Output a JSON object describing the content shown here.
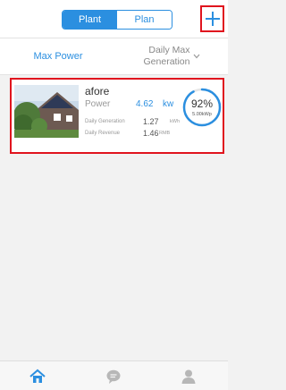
{
  "header": {
    "tabs": [
      {
        "label": "Plant",
        "active": true
      },
      {
        "label": "Plan",
        "active": false
      }
    ],
    "add_icon": "plus-icon"
  },
  "filters": {
    "left_label": "Max Power",
    "right_label": "Daily Max\nGeneration",
    "right_icon": "chevron-down-icon"
  },
  "plants": [
    {
      "name": "afore",
      "power_label": "Power",
      "power_value": "4.62",
      "power_unit": "kw",
      "generation_label": "Daily Generation",
      "generation_value": "1.27",
      "generation_unit": "kWh",
      "revenue_label": "Daily Revenue",
      "revenue_value": "1.46",
      "revenue_unit": "RMB",
      "percent_label": "92%",
      "percent": 0.92,
      "capacity": "5.00kWp"
    }
  ],
  "tabbar": {
    "items": [
      "home-icon",
      "chat-icon",
      "user-icon"
    ]
  },
  "colors": {
    "accent": "#2b8fe0",
    "highlight": "#e0141e",
    "background": "#f2f2f2"
  }
}
